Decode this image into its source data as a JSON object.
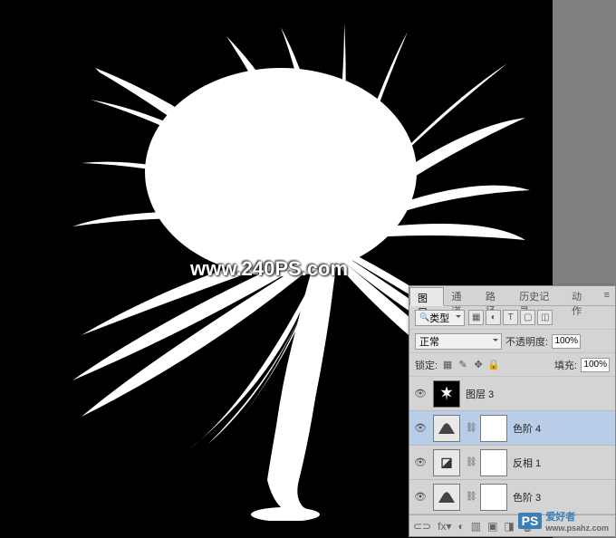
{
  "watermark_main": "www.240PS.com",
  "watermark_side": {
    "brand": "PS",
    "text": "爱好者",
    "url": "www.psahz.com"
  },
  "panel": {
    "tabs": [
      "图层",
      "通道",
      "路径",
      "历史记录",
      "动作"
    ],
    "active_tab": 0,
    "filter_row": {
      "kind_label": "类型",
      "icons": [
        "▦",
        "◐",
        "T",
        "▢",
        "◫"
      ]
    },
    "blend_row": {
      "mode": "正常",
      "opacity_label": "不透明度:",
      "opacity": "100%"
    },
    "lock_row": {
      "label": "锁定:",
      "icons": [
        "▦",
        "✎",
        "✥",
        "🔒"
      ],
      "fill_label": "填充:",
      "fill": "100%"
    },
    "layers": [
      {
        "visible": true,
        "type": "image",
        "name": "图层 3"
      },
      {
        "visible": true,
        "type": "levels",
        "name": "色阶 4",
        "selected": true,
        "has_mask": true
      },
      {
        "visible": true,
        "type": "invert",
        "name": "反相 1",
        "has_mask": true
      },
      {
        "visible": true,
        "type": "levels",
        "name": "色阶 3",
        "has_mask": true
      }
    ],
    "footer_icons": [
      "⊂⊃",
      "fx▾",
      "◐",
      "▥",
      "▣",
      "◨",
      "🗑"
    ]
  }
}
